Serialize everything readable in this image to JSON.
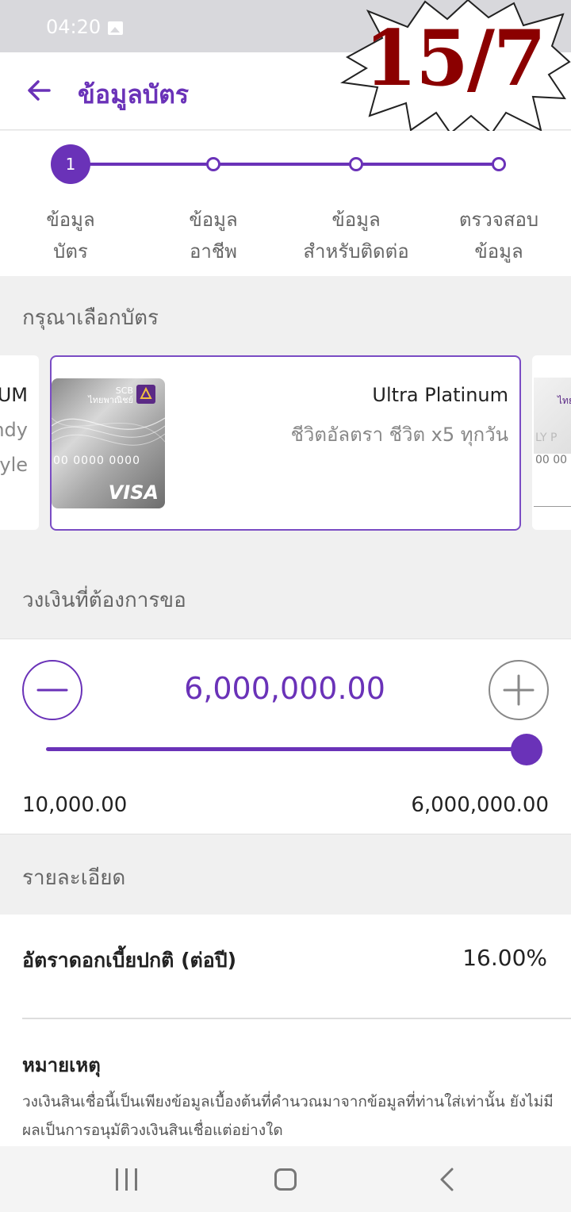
{
  "status": {
    "time": "04:20",
    "image_icon": "image-icon"
  },
  "app_bar": {
    "title": "ข้อมูลบัตร",
    "back_icon": "arrow-left-icon"
  },
  "sticker": {
    "text": "15/7"
  },
  "stepper": {
    "active_index": 1,
    "steps": [
      {
        "number": "1",
        "line1": "ข้อมูล",
        "line2": "บัตร"
      },
      {
        "line1": "ข้อมูล",
        "line2": "อาชีพ"
      },
      {
        "line1": "ข้อมูล",
        "line2": "สำหรับติดต่อ"
      },
      {
        "line1": "ตรวจสอบ",
        "line2": "ข้อมูล"
      }
    ]
  },
  "card_section": {
    "heading": "กรุณาเลือกบัตร",
    "prev_card_fragments": [
      "UM",
      "ndy",
      "tyle"
    ],
    "selected_card": {
      "name": "Ultra Platinum",
      "tagline": "ชีวิตอัลตรา ชีวิต x5 ทุกวัน",
      "brand_logo": "SCB",
      "brand_sub": "ไทยพาณิชย์",
      "number_mask": "00 0000 0000",
      "network": "VISA"
    },
    "next_card_fragments": [
      "ไทย",
      "LY P",
      "00 00"
    ]
  },
  "amount_section": {
    "heading": "วงเงินที่ต้องการขอ",
    "value": "6,000,000.00",
    "min": "10,000.00",
    "max": "6,000,000.00",
    "slider_position": 1.0,
    "minus_icon": "minus-circle-icon",
    "plus_icon": "plus-circle-icon"
  },
  "details_section": {
    "heading": "รายละเอียด",
    "rate_label": "อัตราดอกเบี้ยปกติ (ต่อปี)",
    "rate_value": "16.00%",
    "note_title": "หมายเหตุ",
    "note_text": "วงเงินสินเชื่อนี้เป็นเพียงข้อมูลเบื้องต้นที่คำนวณมาจากข้อมูลที่ท่านใส่เท่านั้น ยังไม่มีผลเป็นการอนุมัติวงเงินสินเชื่อแต่อย่างใด"
  },
  "colors": {
    "primary": "#6a32b8",
    "sticker_text": "#8b0000"
  },
  "nav": {
    "recent_icon": "recent-apps-icon",
    "home_icon": "home-icon",
    "back_icon": "back-icon"
  }
}
